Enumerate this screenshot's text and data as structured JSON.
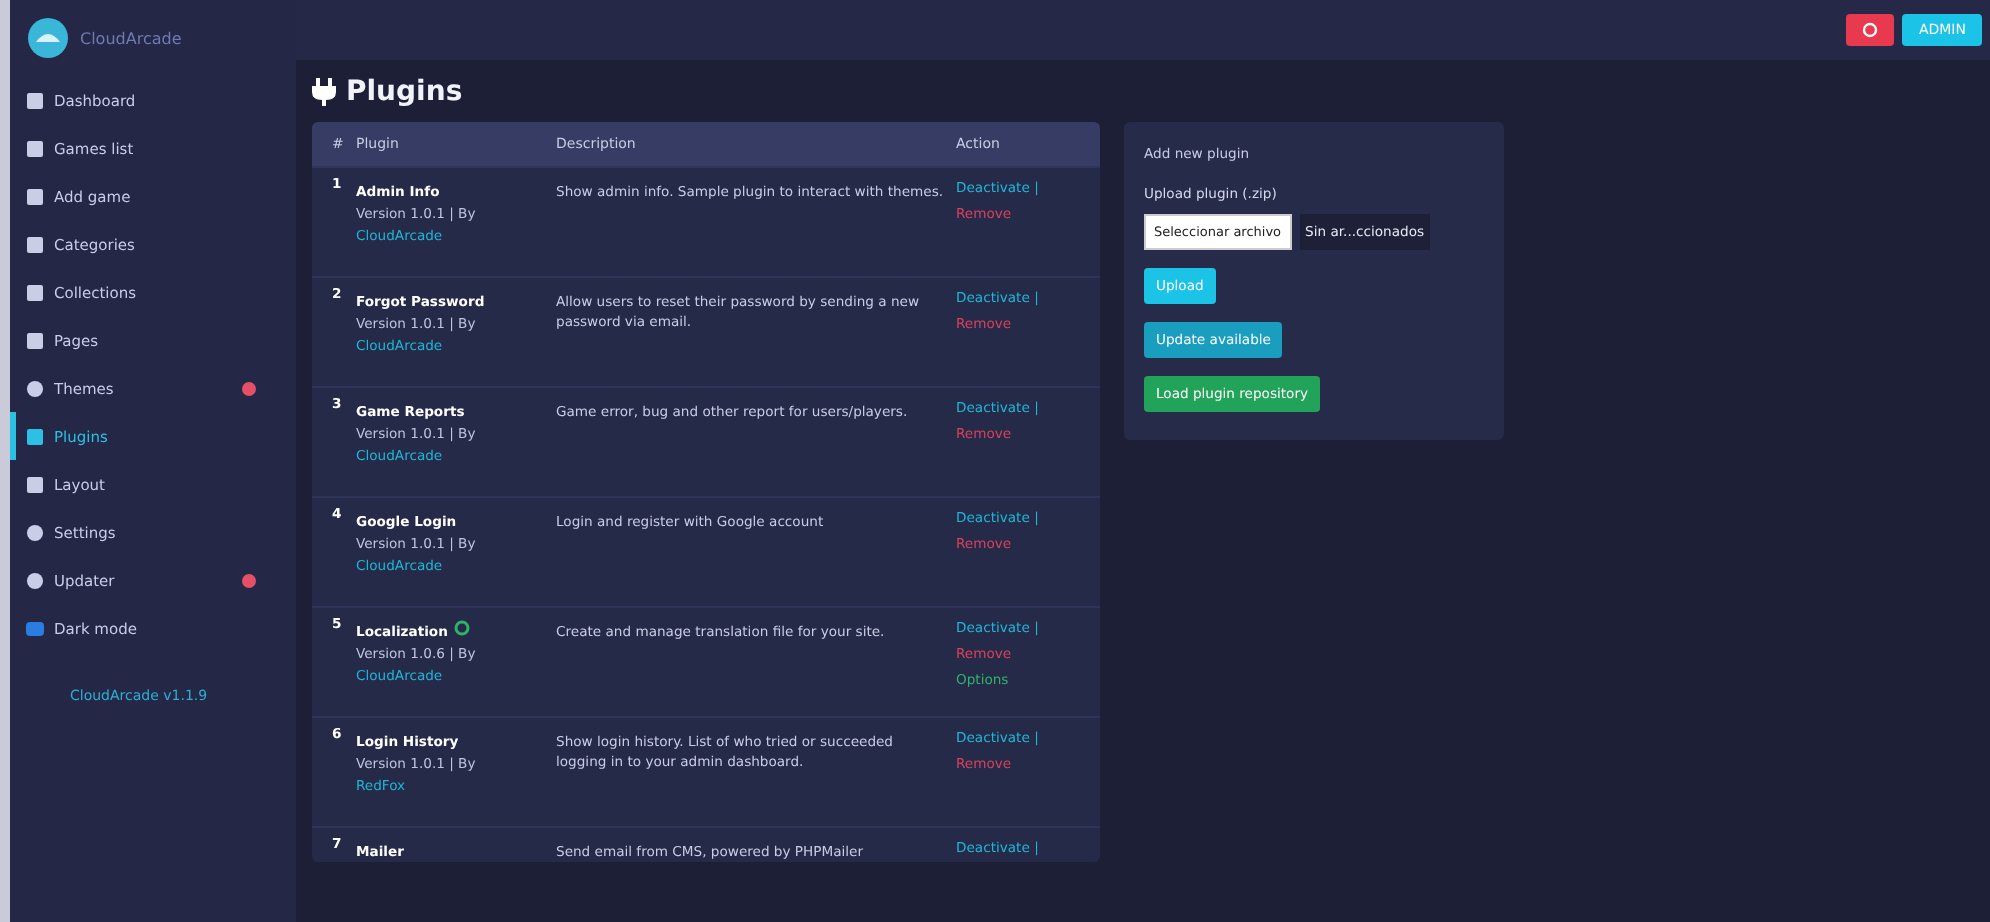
{
  "sidebar": {
    "logo": "CloudArcade",
    "items": [
      {
        "label": "Dashboard",
        "selected": false,
        "badge": false
      },
      {
        "label": "Games list",
        "selected": false,
        "badge": false
      },
      {
        "label": "Add game",
        "selected": false,
        "badge": false
      },
      {
        "label": "Categories",
        "selected": false,
        "badge": false
      },
      {
        "label": "Collections",
        "selected": false,
        "badge": false
      },
      {
        "label": "Pages",
        "selected": false,
        "badge": false
      },
      {
        "label": "Themes",
        "selected": false,
        "badge": true
      },
      {
        "label": "Plugins",
        "selected": true,
        "badge": false
      },
      {
        "label": "Layout",
        "selected": false,
        "badge": false
      },
      {
        "label": "Settings",
        "selected": false,
        "badge": false
      },
      {
        "label": "Updater",
        "selected": false,
        "badge": true
      },
      {
        "label": "Dark mode",
        "selected": false,
        "badge": false
      }
    ],
    "version": "CloudArcade v1.1.9"
  },
  "topbar": {
    "buttons": [
      {
        "kind": "icon",
        "color": "#e8394f"
      },
      {
        "kind": "text",
        "label": "ADMIN",
        "color": "#1bc3e6"
      }
    ]
  },
  "page_title": "Plugins",
  "table": {
    "columns": [
      "#",
      "Plugin",
      "Description",
      "Action"
    ],
    "rows": [
      {
        "index": "1",
        "name": "Admin Info",
        "version": "Version 1.0.1 | By",
        "author": "CloudArcade",
        "description": "Show admin info. Sample plugin to interact with themes.",
        "actions": [
          {
            "label": "Deactivate |",
            "kind": "link"
          },
          {
            "label": "Remove",
            "kind": "danger"
          }
        ]
      },
      {
        "index": "2",
        "name": "Forgot Password",
        "version": "Version 1.0.1 | By",
        "author": "CloudArcade",
        "description": "Allow users to reset their password by sending a new password via email.",
        "actions": [
          {
            "label": "Deactivate |",
            "kind": "link"
          },
          {
            "label": "Remove",
            "kind": "danger"
          }
        ]
      },
      {
        "index": "3",
        "name": "Game Reports",
        "version": "Version 1.0.1 | By",
        "author": "CloudArcade",
        "description": "Game error, bug and other report for users/players.",
        "actions": [
          {
            "label": "Deactivate |",
            "kind": "link"
          },
          {
            "label": "Remove",
            "kind": "danger"
          }
        ]
      },
      {
        "index": "4",
        "name": "Google Login",
        "version": "Version 1.0.1 | By",
        "author": "CloudArcade",
        "description": "Login and register with Google account",
        "actions": [
          {
            "label": "Deactivate |",
            "kind": "link"
          },
          {
            "label": "Remove",
            "kind": "danger"
          }
        ]
      },
      {
        "index": "5",
        "name": "Localization",
        "settings": true,
        "version": "Version 1.0.6 | By",
        "author": "CloudArcade",
        "description": "Create and manage translation file for your site.",
        "actions": [
          {
            "label": "Deactivate |",
            "kind": "link"
          },
          {
            "label": "Remove",
            "kind": "danger"
          },
          {
            "label": "Options",
            "kind": "success"
          }
        ]
      },
      {
        "index": "6",
        "name": "Login History",
        "version": "Version 1.0.1 | By",
        "author": "RedFox",
        "description": "Show login history. List of who tried or succeeded logging in to your admin dashboard.",
        "actions": [
          {
            "label": "Deactivate |",
            "kind": "link"
          },
          {
            "label": "Remove",
            "kind": "danger"
          }
        ]
      },
      {
        "index": "7",
        "name": "Mailer",
        "description": "Send email from CMS, powered by PHPMailer",
        "actions": [
          {
            "label": "Deactivate |",
            "kind": "link"
          }
        ]
      }
    ]
  },
  "upload": {
    "title": "Add new plugin",
    "label": "Upload plugin (.zip)",
    "file_button": "Seleccionar archivo",
    "file_status": "Sin ar...ccionados",
    "buttons": [
      {
        "label": "Upload",
        "kind": "info"
      },
      {
        "label": "Update available",
        "kind": "secondary"
      },
      {
        "label": "Load plugin repository",
        "kind": "success"
      }
    ]
  }
}
